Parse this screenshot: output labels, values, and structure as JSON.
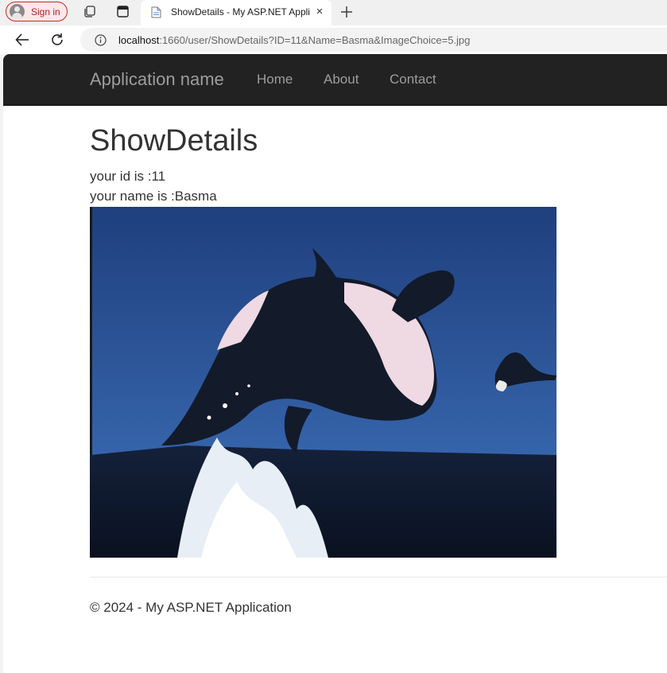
{
  "browser": {
    "signin_label": "Sign in",
    "tab_title": "ShowDetails - My ASP.NET Appli",
    "close_glyph": "×",
    "url_host": "localhost",
    "url_rest": ":1660/user/ShowDetails?ID=11&Name=Basma&ImageChoice=5.jpg"
  },
  "site": {
    "brand": "Application name",
    "nav": [
      "Home",
      "About",
      "Contact"
    ]
  },
  "content": {
    "heading": "ShowDetails",
    "id_line": "your id is :11",
    "name_line": "your name is :Basma"
  },
  "footer": {
    "text": "© 2024 - My ASP.NET Application"
  },
  "colors": {
    "navbar_bg": "#222222",
    "nav_text": "#9d9d9d",
    "body_text": "#333333",
    "signin_accent": "#c42b1c"
  },
  "icons": [
    "person-icon",
    "collections-icon",
    "tab-actions-icon",
    "page-favicon",
    "close-icon",
    "plus-icon",
    "back-arrow-icon",
    "refresh-icon",
    "info-icon"
  ]
}
